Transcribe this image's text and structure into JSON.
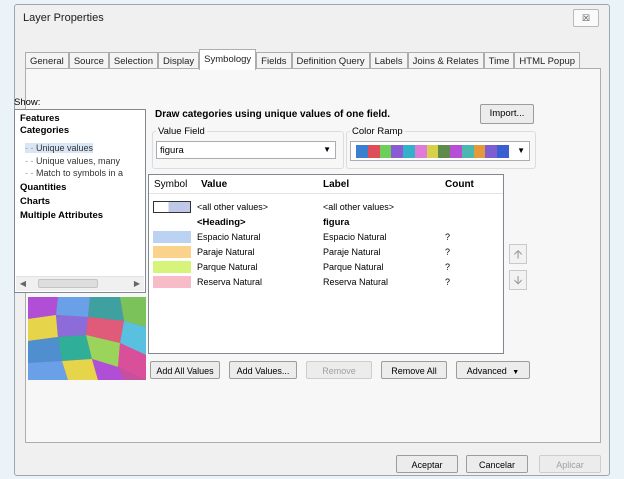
{
  "window": {
    "title": "Layer Properties",
    "close_label": "☒"
  },
  "tabs": [
    "General",
    "Source",
    "Selection",
    "Display",
    "Symbology",
    "Fields",
    "Definition Query",
    "Labels",
    "Joins & Relates",
    "Time",
    "HTML Popup"
  ],
  "active_tab": "Symbology",
  "show": {
    "label": "Show:",
    "items": [
      {
        "label": "Features",
        "bold": true
      },
      {
        "label": "Categories",
        "bold": true
      },
      {
        "label": "Unique values",
        "sub": true,
        "selected": true
      },
      {
        "label": "Unique values, many",
        "sub": true
      },
      {
        "label": "Match to symbols in a",
        "sub": true
      },
      {
        "label": "Quantities",
        "bold": true
      },
      {
        "label": "Charts",
        "bold": true
      },
      {
        "label": "Multiple Attributes",
        "bold": true
      }
    ]
  },
  "description": "Draw categories using unique values of one field.",
  "import_button": "Import...",
  "value_field": {
    "label": "Value Field",
    "value": "figura"
  },
  "color_ramp": {
    "label": "Color Ramp",
    "colors": [
      "#3a7fd0",
      "#e04d5a",
      "#6ccf5a",
      "#8b5bd6",
      "#33b1c9",
      "#e07bd8",
      "#d7d04a",
      "#5f8b4a",
      "#b74fd6",
      "#4ab7b0",
      "#e49a3c",
      "#7f5fcf",
      "#3a5fd0"
    ]
  },
  "table": {
    "headers": {
      "symbol": "Symbol",
      "value": "Value",
      "label": "Label",
      "count": "Count"
    },
    "rows": [
      {
        "color": "#c0c8ea",
        "value": "<all other values>",
        "label": "<all other values>",
        "count": ""
      },
      {
        "heading": true,
        "value": "<Heading>",
        "label": "figura",
        "count": ""
      },
      {
        "color": "#bcd2f2",
        "value": "Espacio Natural",
        "label": "Espacio Natural",
        "count": "?"
      },
      {
        "color": "#fbd28c",
        "value": "Paraje Natural",
        "label": "Paraje Natural",
        "count": "?"
      },
      {
        "color": "#d6f47a",
        "value": "Parque Natural",
        "label": "Parque Natural",
        "count": "?"
      },
      {
        "color": "#f7bcc8",
        "value": "Reserva Natural",
        "label": "Reserva Natural",
        "count": "?"
      }
    ]
  },
  "buttons": {
    "add_all": "Add All Values",
    "add_values": "Add Values...",
    "remove": "Remove",
    "remove_all": "Remove All",
    "advanced": "Advanced"
  },
  "dialog_buttons": {
    "ok": "Aceptar",
    "cancel": "Cancelar",
    "apply": "Aplicar"
  }
}
